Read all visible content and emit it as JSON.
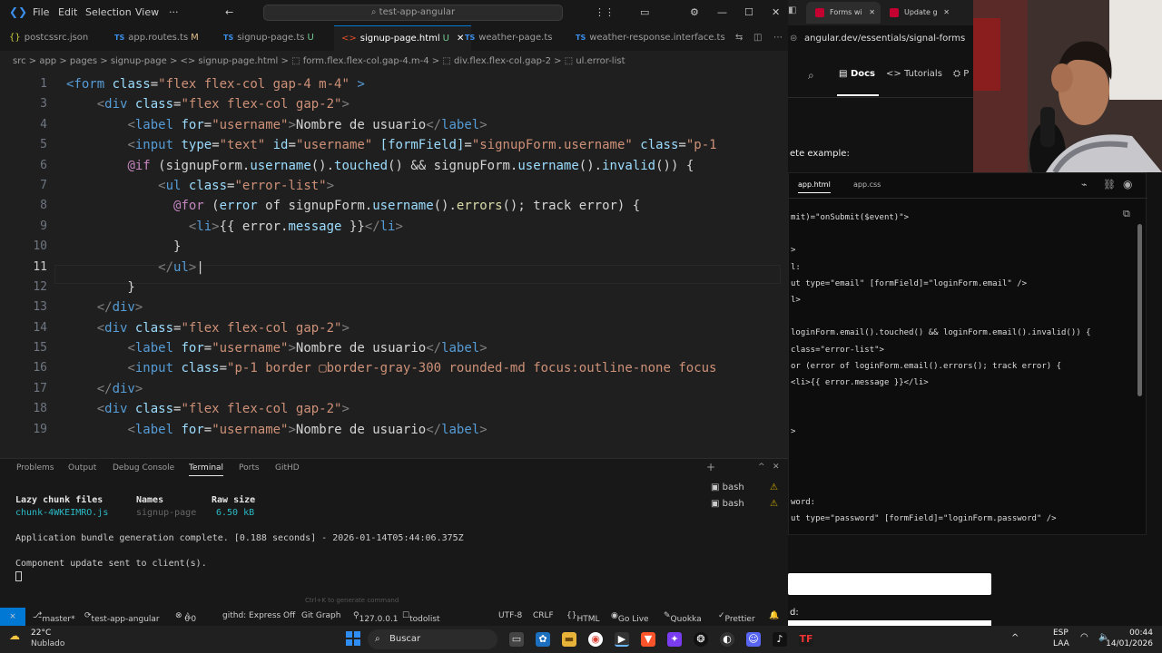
{
  "titlebar": {
    "menus": [
      "File",
      "Edit",
      "Selection",
      "View",
      "···"
    ],
    "search": "test-app-angular"
  },
  "tabs": [
    {
      "label": "postcssrc.json",
      "icon": "{}",
      "mod": ""
    },
    {
      "label": "app.routes.ts",
      "icon": "TS",
      "mod": "M"
    },
    {
      "label": "signup-page.ts",
      "icon": "TS",
      "mod": "U"
    },
    {
      "label": "signup-page.html",
      "icon": "<>",
      "mod": "U"
    },
    {
      "label": "weather-page.ts",
      "icon": "TS",
      "mod": ""
    },
    {
      "label": "weather-response.interface.ts",
      "icon": "TS",
      "mod": ""
    }
  ],
  "breadcrumb": "src > app > pages > signup-page > <> signup-page.html > ⬚ form.flex.flex-col.gap-4.m-4 > ⬚ div.flex.flex-col.gap-2 > ⬚ ul.error-list",
  "line_numbers": [
    "1",
    "3",
    "4",
    "5",
    "6",
    "7",
    "8",
    "9",
    "10",
    "11",
    "12",
    "13",
    "14",
    "15",
    "16",
    "17",
    "18",
    "19"
  ],
  "terminal": {
    "tabs": [
      "Problems",
      "Output",
      "Debug Console",
      "Terminal",
      "Ports",
      "GitHD"
    ],
    "col_file": "Lazy chunk files",
    "col_names": "Names",
    "col_size": "Raw size",
    "row_file": "chunk-4WKEIMRO.js",
    "row_name": "signup-page",
    "row_size": "6.50 kB",
    "line1": "Application bundle generation complete. [0.188 seconds] - 2026-01-14T05:44:06.375Z",
    "line2": "Component update sent to client(s).",
    "hint": "Ctrl+K to generate command",
    "shells": [
      "bash",
      "bash"
    ]
  },
  "status": {
    "branch": "master*",
    "project": "test-app-angular",
    "errors": "0",
    "warnings": "0",
    "githd": "githd: Express Off",
    "graph": "Git Graph",
    "host": "127.0.0.1",
    "todo": "todolist",
    "encoding": "UTF-8",
    "eol": "CRLF",
    "lang": "HTML",
    "golive": "Go Live",
    "quokka": "Quokka",
    "prettier": "Prettier"
  },
  "browser": {
    "tabs": [
      "Forms wi",
      "Update g"
    ],
    "url": "angular.dev/essentials/signal-forms",
    "nav_docs": "Docs",
    "nav_tutorials": "Tutorials",
    "nav_more": "P",
    "example_text": "ete example:",
    "file_tabs": [
      "app.html",
      "app.css"
    ],
    "label_word": "ord:",
    "label_d": "d:"
  },
  "browser_code": [
    "mit)=\"onSubmit($event)\">",
    "",
    ">",
    "l:",
    "ut type=\"email\" [formField]=\"loginForm.email\" />",
    "l>",
    "",
    "loginForm.email().touched() && loginForm.email().invalid()) {",
    "class=\"error-list\">",
    "or (error of loginForm.email().errors(); track error) {",
    "<li>{{ error.message }}</li>",
    "",
    "",
    ">"
  ],
  "browser_code2": [
    "word:",
    "ut type=\"password\" [formField]=\"loginForm.password\" />"
  ],
  "taskbar": {
    "temp": "22°C",
    "weather": "Nublado",
    "search": "Buscar",
    "lang1": "ESP",
    "lang2": "LAA",
    "time": "00:44",
    "date": "14/01/2026"
  }
}
